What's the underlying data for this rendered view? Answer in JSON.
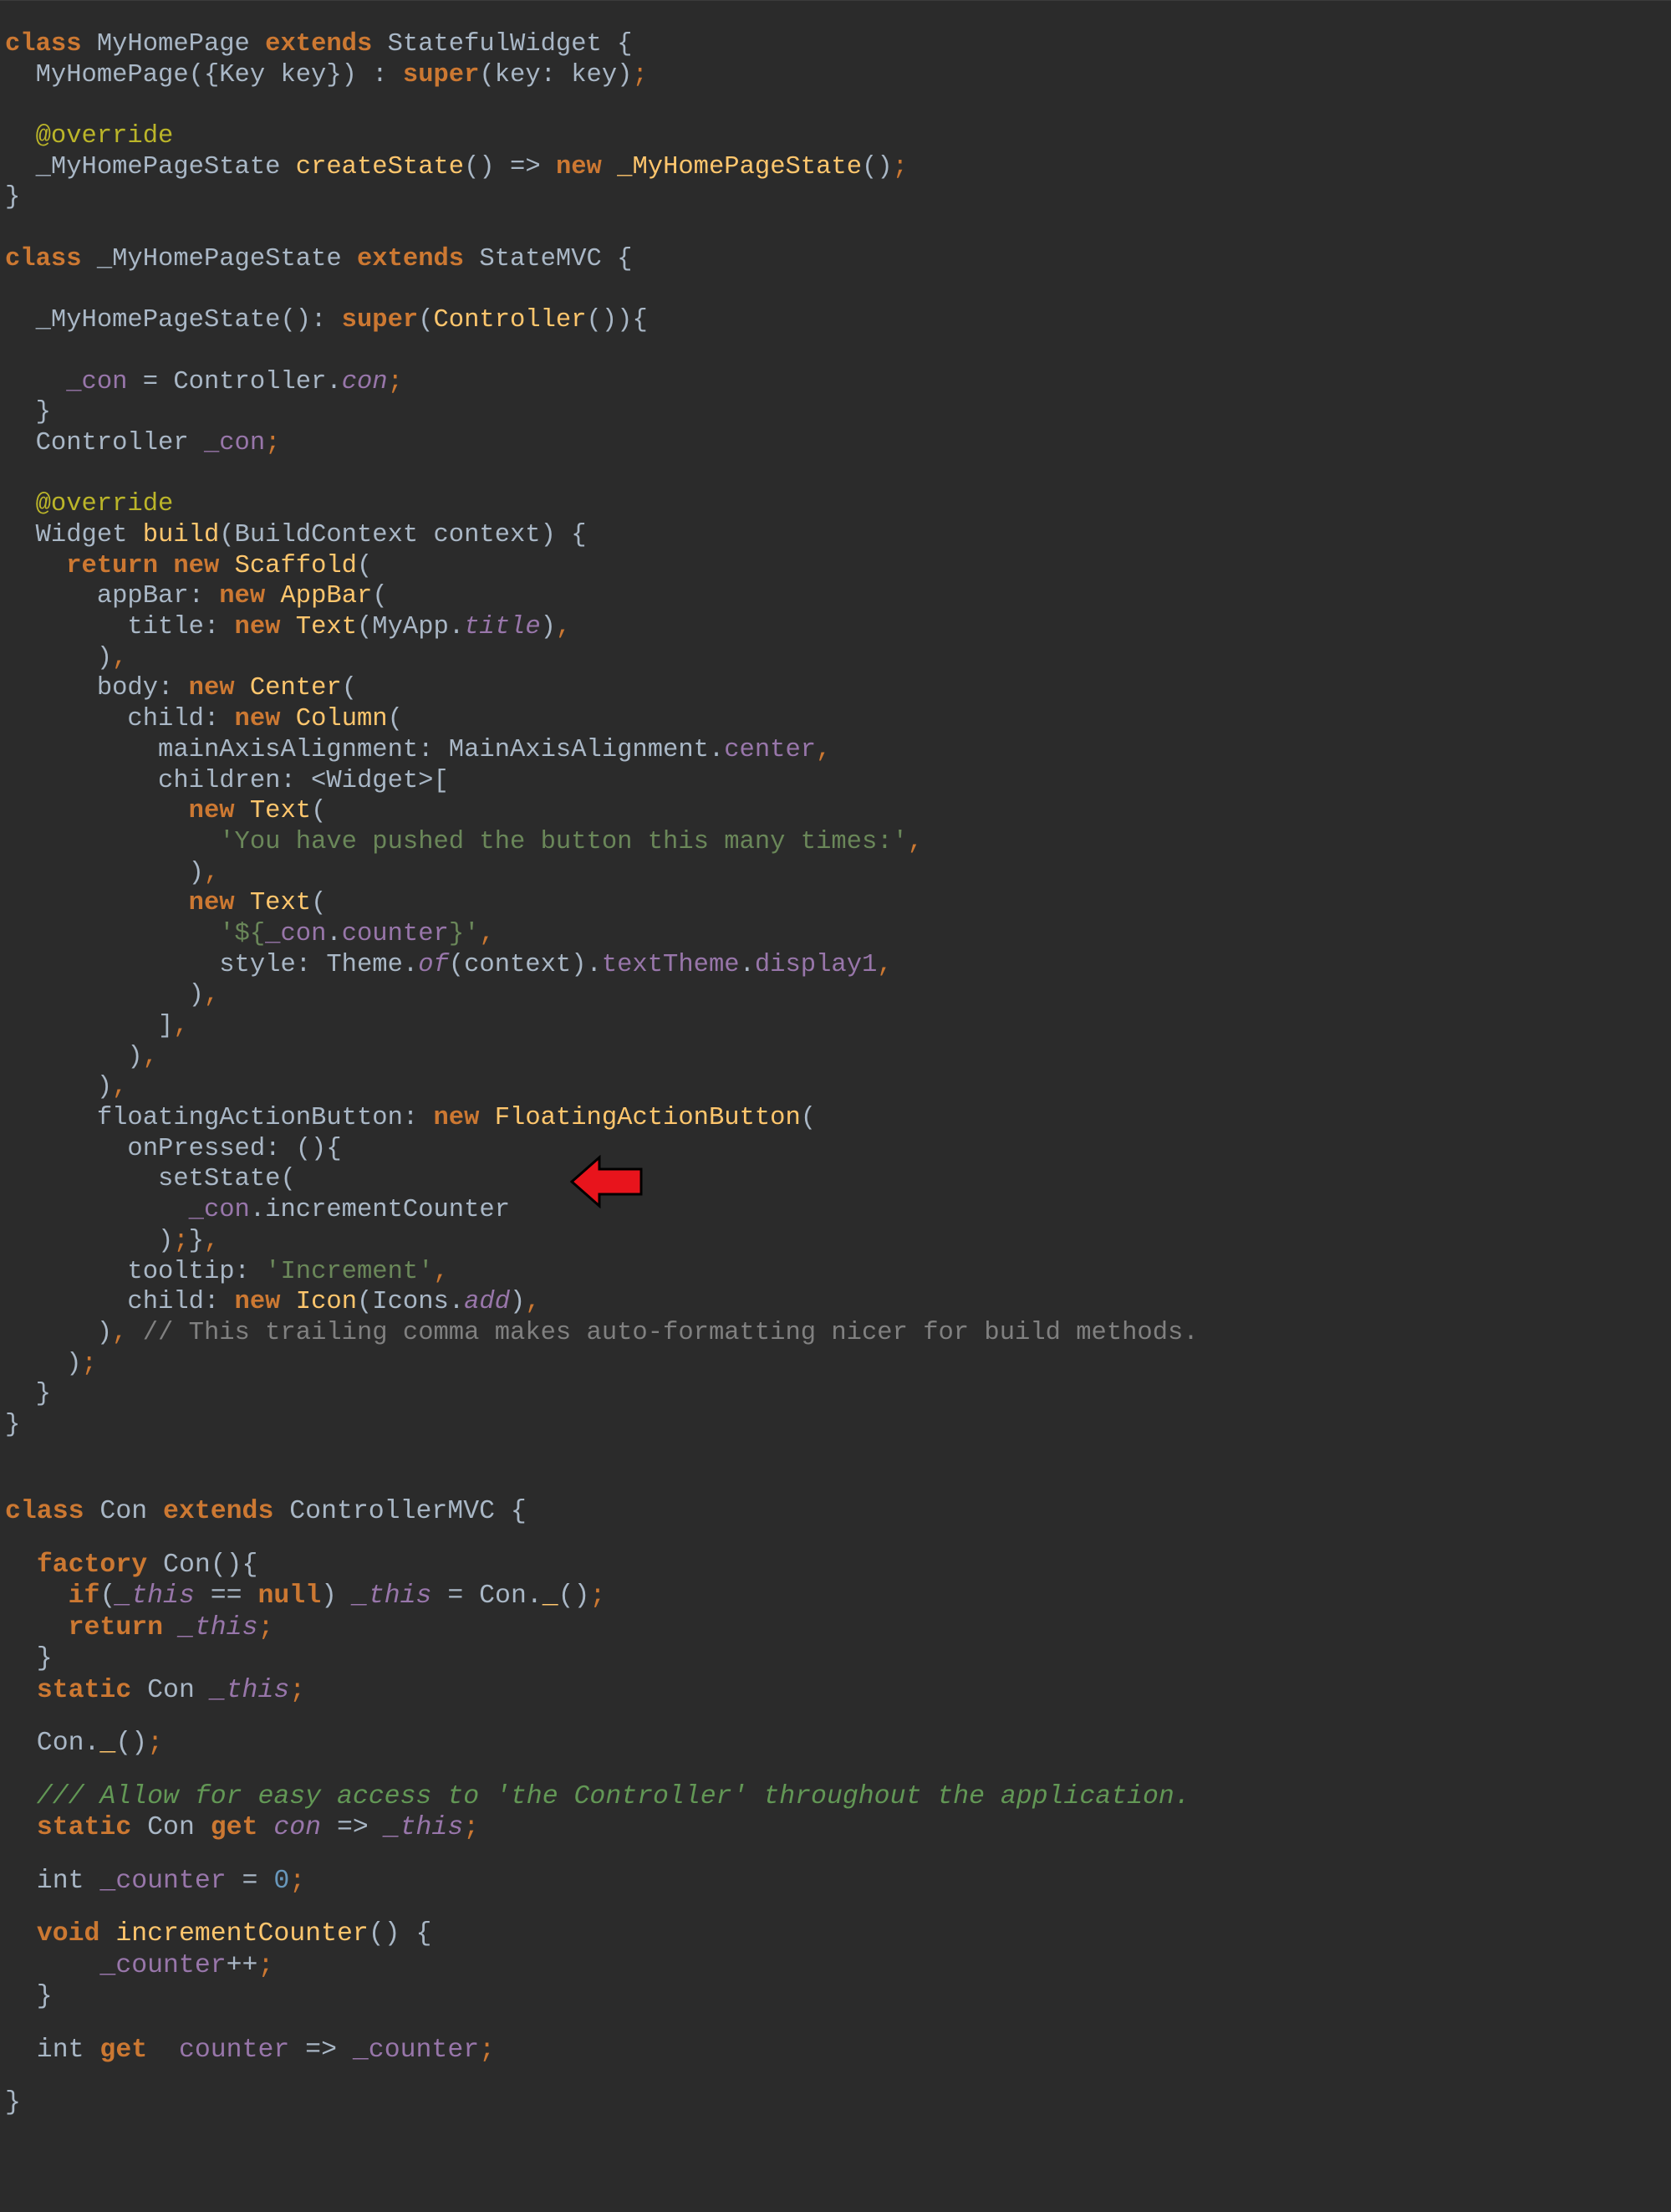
{
  "editor": {
    "theme_colors": {
      "background": "#2b2b2b",
      "keyword": "#cc7832",
      "class_name": "#ffc66d",
      "plain": "#a9b7c6",
      "field": "#9876aa",
      "string": "#6a8759",
      "annotation": "#bbb529",
      "comment": "#808080",
      "doc_comment": "#629755",
      "number": "#6897bb"
    },
    "code_lines": [
      [
        [
          "kw",
          "class"
        ],
        [
          "pl",
          " MyHomePage "
        ],
        [
          "kw",
          "extends"
        ],
        [
          "pl",
          " StatefulWidget {"
        ]
      ],
      [
        [
          "pl",
          "  MyHomePage({Key key}) : "
        ],
        [
          "kw",
          "super"
        ],
        [
          "pl",
          "(key: key)"
        ],
        [
          "pu",
          ";"
        ]
      ],
      [],
      [
        [
          "an",
          "  @override"
        ]
      ],
      [
        [
          "pl",
          "  _MyHomePageState "
        ],
        [
          "fn",
          "createState"
        ],
        [
          "pl",
          "() => "
        ],
        [
          "kw",
          "new"
        ],
        [
          "pl",
          " "
        ],
        [
          "fn",
          "_MyHomePageState"
        ],
        [
          "pl",
          "()"
        ],
        [
          "pu",
          ";"
        ]
      ],
      [
        [
          "pl",
          "}"
        ]
      ],
      [],
      [
        [
          "kw",
          "class"
        ],
        [
          "pl",
          " _MyHomePageState "
        ],
        [
          "kw",
          "extends"
        ],
        [
          "pl",
          " StateMVC {"
        ]
      ],
      [],
      [
        [
          "pl",
          "  _MyHomePageState(): "
        ],
        [
          "kw",
          "super"
        ],
        [
          "pl",
          "("
        ],
        [
          "fn",
          "Controller"
        ],
        [
          "pl",
          "()){"
        ]
      ],
      [],
      [
        [
          "pl",
          "    "
        ],
        [
          "fd",
          "_con"
        ],
        [
          "pl",
          " = Controller."
        ],
        [
          "fi",
          "con"
        ],
        [
          "pu",
          ";"
        ]
      ],
      [
        [
          "pl",
          "  }"
        ]
      ],
      [
        [
          "pl",
          "  Controller "
        ],
        [
          "fd",
          "_con"
        ],
        [
          "pu",
          ";"
        ]
      ],
      [],
      [
        [
          "an",
          "  @override"
        ]
      ],
      [
        [
          "pl",
          "  Widget "
        ],
        [
          "fn",
          "build"
        ],
        [
          "pl",
          "(BuildContext context) {"
        ]
      ],
      [
        [
          "pl",
          "    "
        ],
        [
          "kw",
          "return new"
        ],
        [
          "pl",
          " "
        ],
        [
          "fn",
          "Scaffold"
        ],
        [
          "pl",
          "("
        ]
      ],
      [
        [
          "pl",
          "      appBar: "
        ],
        [
          "kw",
          "new"
        ],
        [
          "pl",
          " "
        ],
        [
          "fn",
          "AppBar"
        ],
        [
          "pl",
          "("
        ]
      ],
      [
        [
          "pl",
          "        title: "
        ],
        [
          "kw",
          "new"
        ],
        [
          "pl",
          " "
        ],
        [
          "fn",
          "Text"
        ],
        [
          "pl",
          "(MyApp."
        ],
        [
          "fi",
          "title"
        ],
        [
          "pl",
          ")"
        ],
        [
          "pu",
          ","
        ]
      ],
      [
        [
          "pl",
          "      )"
        ],
        [
          "pu",
          ","
        ]
      ],
      [
        [
          "pl",
          "      body: "
        ],
        [
          "kw",
          "new"
        ],
        [
          "pl",
          " "
        ],
        [
          "fn",
          "Center"
        ],
        [
          "pl",
          "("
        ]
      ],
      [
        [
          "pl",
          "        child: "
        ],
        [
          "kw",
          "new"
        ],
        [
          "pl",
          " "
        ],
        [
          "fn",
          "Column"
        ],
        [
          "pl",
          "("
        ]
      ],
      [
        [
          "pl",
          "          mainAxisAlignment: MainAxisAlignment."
        ],
        [
          "fd",
          "center"
        ],
        [
          "pu",
          ","
        ]
      ],
      [
        [
          "pl",
          "          children: <Widget>["
        ]
      ],
      [
        [
          "pl",
          "            "
        ],
        [
          "kw",
          "new"
        ],
        [
          "pl",
          " "
        ],
        [
          "fn",
          "Text"
        ],
        [
          "pl",
          "("
        ]
      ],
      [
        [
          "pl",
          "              "
        ],
        [
          "st",
          "'You have pushed the button this many times:'"
        ],
        [
          "pu",
          ","
        ]
      ],
      [
        [
          "pl",
          "            )"
        ],
        [
          "pu",
          ","
        ]
      ],
      [
        [
          "pl",
          "            "
        ],
        [
          "kw",
          "new"
        ],
        [
          "pl",
          " "
        ],
        [
          "fn",
          "Text"
        ],
        [
          "pl",
          "("
        ]
      ],
      [
        [
          "pl",
          "              "
        ],
        [
          "st",
          "'${"
        ],
        [
          "fd",
          "_con"
        ],
        [
          "pl",
          "."
        ],
        [
          "fd",
          "counter"
        ],
        [
          "st",
          "}'"
        ],
        [
          "pu",
          ","
        ]
      ],
      [
        [
          "pl",
          "              style: Theme."
        ],
        [
          "fi",
          "of"
        ],
        [
          "pl",
          "(context)."
        ],
        [
          "fd",
          "textTheme"
        ],
        [
          "pl",
          "."
        ],
        [
          "fd",
          "display1"
        ],
        [
          "pu",
          ","
        ]
      ],
      [
        [
          "pl",
          "            )"
        ],
        [
          "pu",
          ","
        ]
      ],
      [
        [
          "pl",
          "          ]"
        ],
        [
          "pu",
          ","
        ]
      ],
      [
        [
          "pl",
          "        )"
        ],
        [
          "pu",
          ","
        ]
      ],
      [
        [
          "pl",
          "      )"
        ],
        [
          "pu",
          ","
        ]
      ],
      [
        [
          "pl",
          "      floatingActionButton: "
        ],
        [
          "kw",
          "new"
        ],
        [
          "pl",
          " "
        ],
        [
          "fn",
          "FloatingActionButton"
        ],
        [
          "pl",
          "("
        ]
      ],
      [
        [
          "pl",
          "        onPressed: (){"
        ]
      ],
      [
        [
          "pl",
          "          setState("
        ]
      ],
      [
        [
          "pl",
          "            "
        ],
        [
          "fd",
          "_con"
        ],
        [
          "pl",
          ".incrementCounter"
        ]
      ],
      [
        [
          "pl",
          "          )"
        ],
        [
          "pu",
          ";"
        ],
        [
          "pl",
          "}"
        ],
        [
          "pu",
          ","
        ]
      ],
      [
        [
          "pl",
          "        tooltip: "
        ],
        [
          "st",
          "'Increment'"
        ],
        [
          "pu",
          ","
        ]
      ],
      [
        [
          "pl",
          "        child: "
        ],
        [
          "kw",
          "new"
        ],
        [
          "pl",
          " "
        ],
        [
          "fn",
          "Icon"
        ],
        [
          "pl",
          "(Icons."
        ],
        [
          "fi",
          "add"
        ],
        [
          "pl",
          ")"
        ],
        [
          "pu",
          ","
        ]
      ],
      [
        [
          "pl",
          "      )"
        ],
        [
          "pu",
          ","
        ],
        [
          "cm",
          " // This trailing comma makes auto-formatting nicer for build methods."
        ]
      ],
      [
        [
          "pl",
          "    )"
        ],
        [
          "pu",
          ";"
        ]
      ],
      [
        [
          "pl",
          "  }"
        ]
      ],
      [
        [
          "pl",
          "}"
        ]
      ]
    ],
    "code_lines_b": [
      [
        [
          "kw",
          "class"
        ],
        [
          "pl",
          " Con "
        ],
        [
          "kw",
          "extends"
        ],
        [
          "pl",
          " ControllerMVC {"
        ]
      ],
      [],
      [
        [
          "pl",
          "  "
        ],
        [
          "kw",
          "factory"
        ],
        [
          "pl",
          " Con(){"
        ]
      ],
      [
        [
          "pl",
          "    "
        ],
        [
          "kw",
          "if"
        ],
        [
          "pl",
          "("
        ],
        [
          "fi",
          "_this"
        ],
        [
          "pl",
          " == "
        ],
        [
          "kw",
          "null"
        ],
        [
          "pl",
          ") "
        ],
        [
          "fi",
          "_this"
        ],
        [
          "pl",
          " = Con."
        ],
        [
          "fn",
          "_"
        ],
        [
          "pl",
          "()"
        ],
        [
          "pu",
          ";"
        ]
      ],
      [
        [
          "pl",
          "    "
        ],
        [
          "kw",
          "return"
        ],
        [
          "pl",
          " "
        ],
        [
          "fi",
          "_this"
        ],
        [
          "pu",
          ";"
        ]
      ],
      [
        [
          "pl",
          "  }"
        ]
      ],
      [
        [
          "pl",
          "  "
        ],
        [
          "kw",
          "static"
        ],
        [
          "pl",
          " Con "
        ],
        [
          "fi",
          "_this"
        ],
        [
          "pu",
          ";"
        ]
      ],
      [],
      [
        [
          "pl",
          "  Con."
        ],
        [
          "fn",
          "_"
        ],
        [
          "pl",
          "()"
        ],
        [
          "pu",
          ";"
        ]
      ],
      [],
      [
        [
          "dc",
          "  /// Allow for easy access to 'the Controller' throughout the application."
        ]
      ],
      [
        [
          "pl",
          "  "
        ],
        [
          "kw",
          "static"
        ],
        [
          "pl",
          " Con "
        ],
        [
          "kw",
          "get"
        ],
        [
          "pl",
          " "
        ],
        [
          "fi",
          "con"
        ],
        [
          "pl",
          " => "
        ],
        [
          "fi",
          "_this"
        ],
        [
          "pu",
          ";"
        ]
      ],
      [],
      [
        [
          "pl",
          "  int "
        ],
        [
          "fd",
          "_counter"
        ],
        [
          "pl",
          " = "
        ],
        [
          "nm",
          "0"
        ],
        [
          "pu",
          ";"
        ]
      ],
      [],
      [
        [
          "pl",
          "  "
        ],
        [
          "kw",
          "void"
        ],
        [
          "pl",
          " "
        ],
        [
          "fn",
          "incrementCounter"
        ],
        [
          "pl",
          "() {"
        ]
      ],
      [
        [
          "pl",
          "      "
        ],
        [
          "fd",
          "_counter"
        ],
        [
          "pl",
          "++"
        ],
        [
          "pu",
          ";"
        ]
      ],
      [
        [
          "pl",
          "  }"
        ]
      ],
      [],
      [
        [
          "pl",
          "  int "
        ],
        [
          "kw",
          "get"
        ],
        [
          "pl",
          "  "
        ],
        [
          "fd",
          "counter"
        ],
        [
          "pl",
          " => "
        ],
        [
          "fd",
          "_counter"
        ],
        [
          "pu",
          ";"
        ]
      ],
      [],
      [
        [
          "pl",
          "}"
        ]
      ]
    ]
  },
  "annotation": {
    "arrow_color": "#e8141c",
    "arrow_icon": "left-arrow-icon"
  }
}
